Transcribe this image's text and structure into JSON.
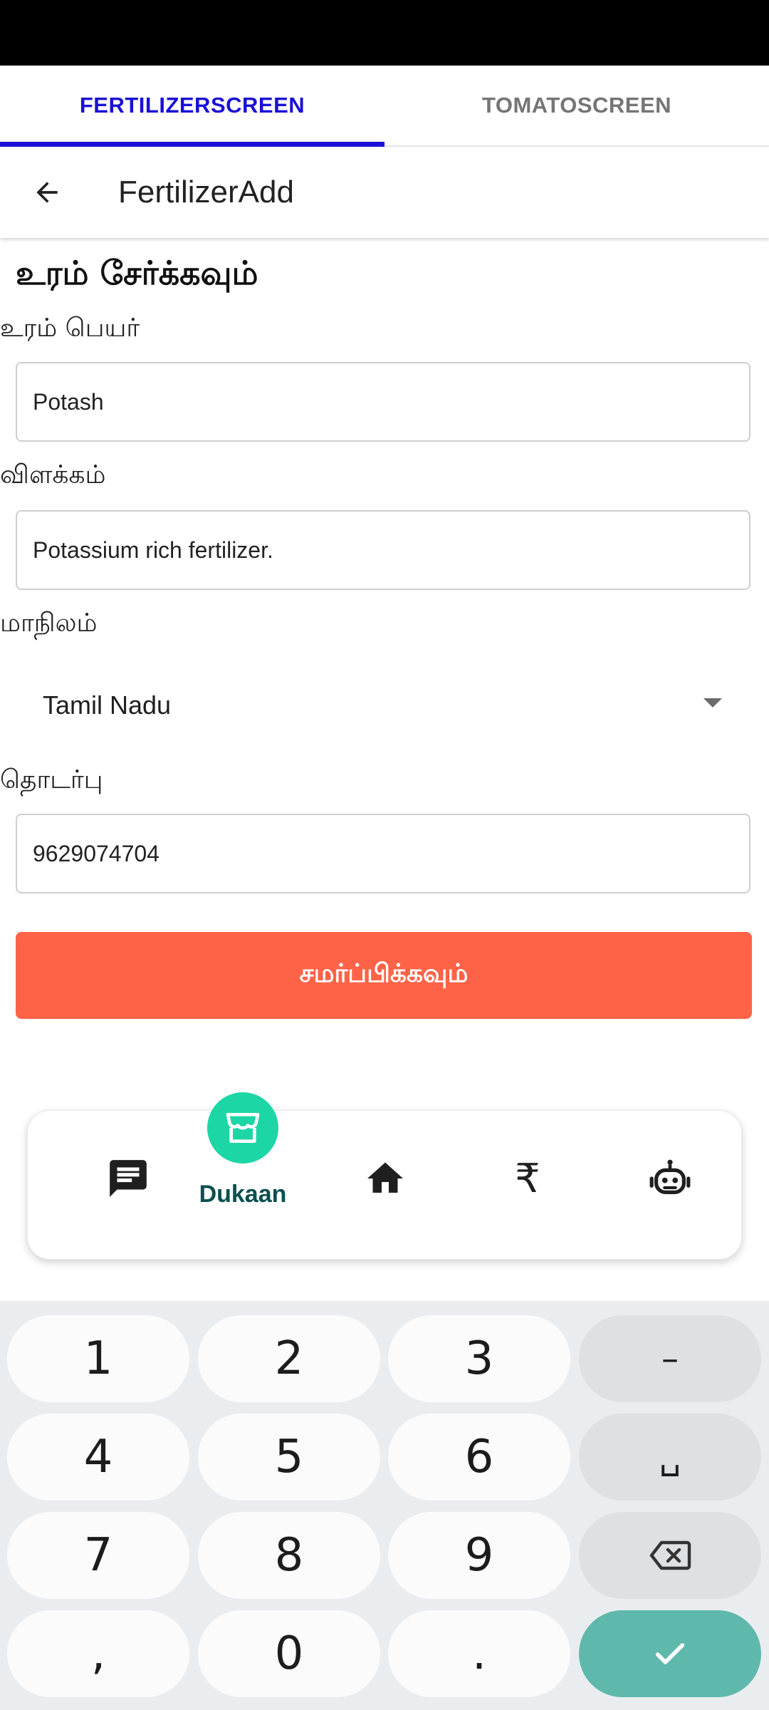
{
  "tabs": [
    {
      "label": "FERTILIZERSCREEN",
      "active": true
    },
    {
      "label": "TOMATOSCREEN",
      "active": false
    }
  ],
  "appbar": {
    "title": "FertilizerAdd",
    "back_icon": "arrow-left-icon"
  },
  "form": {
    "heading": "உரம் சேர்க்கவும்",
    "name_label": "உரம் பெயர்",
    "name_value": "Potash",
    "description_label": "விளக்கம்",
    "description_value": "Potassium rich fertilizer.",
    "state_label": "மாநிலம்",
    "state_value": "Tamil Nadu",
    "contact_label": "தொடர்பு",
    "contact_value": "9629074704",
    "submit_label": "சமர்ப்பிக்கவும்"
  },
  "bottom_nav": {
    "items": [
      {
        "icon": "chat-icon"
      },
      {
        "icon": "store-icon",
        "label": "Dukaan",
        "active": true
      },
      {
        "icon": "home-icon"
      },
      {
        "icon": "rupee-icon",
        "glyph": "₹"
      },
      {
        "icon": "robot-icon"
      }
    ],
    "active_color": "#1dd6a6"
  },
  "keyboard": {
    "keys": [
      "1",
      "2",
      "3",
      "–",
      "4",
      "5",
      "6",
      "␣",
      "7",
      "8",
      "9",
      "⌫",
      ",",
      "0",
      ".",
      "✓"
    ]
  },
  "colors": {
    "accent": "#1a10d6",
    "submit": "#ff6347",
    "done_key": "#5eb9ac"
  }
}
